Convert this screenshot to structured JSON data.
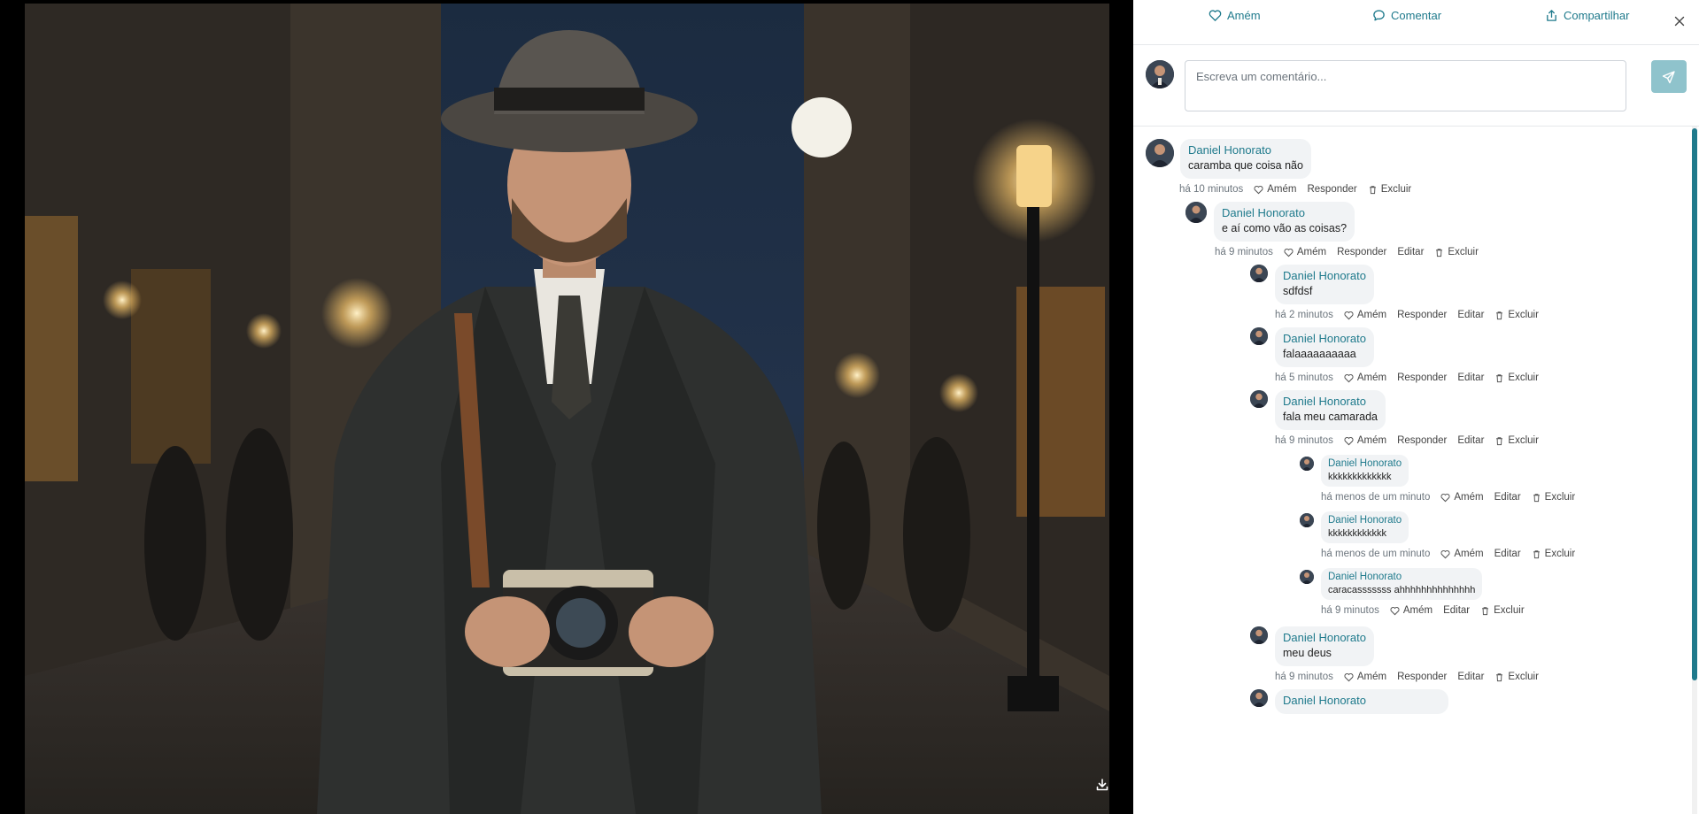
{
  "viewer": {
    "download_icon": "download-icon"
  },
  "actions": {
    "amen_label": "Amém",
    "comment_label": "Comentar",
    "share_label": "Compartilhar",
    "close_icon": "close-icon"
  },
  "composer": {
    "placeholder": "Escreva um comentário...",
    "value": ""
  },
  "colors": {
    "accent": "#1f7a8c",
    "send_button": "#8fc3cc",
    "bubble": "#f1f3f5"
  },
  "labels": {
    "amen": "Amém",
    "reply": "Responder",
    "edit": "Editar",
    "delete": "Excluir"
  },
  "comments": [
    {
      "author": "Daniel Honorato",
      "text": "caramba que coisa não",
      "time": "há 10 minutos"
    },
    {
      "author": "Daniel Honorato",
      "text": "e aí como vão as coisas?",
      "time": "há 9 minutos"
    },
    {
      "author": "Daniel Honorato",
      "text": "sdfdsf",
      "time": "há 2 minutos"
    },
    {
      "author": "Daniel Honorato",
      "text": "falaaaaaaaaaa",
      "time": "há 5 minutos"
    },
    {
      "author": "Daniel Honorato",
      "text": "fala meu camarada",
      "time": "há 9 minutos"
    },
    {
      "author": "Daniel Honorato",
      "text": "kkkkkkkkkkkkk",
      "time": "há menos de um minuto"
    },
    {
      "author": "Daniel Honorato",
      "text": "kkkkkkkkkkkk",
      "time": "há menos de um minuto"
    },
    {
      "author": "Daniel Honorato",
      "text": "caracasssssss ahhhhhhhhhhhhhh",
      "time": "há 9 minutos"
    },
    {
      "author": "Daniel Honorato",
      "text": "meu deus",
      "time": "há 9 minutos"
    },
    {
      "author": "Daniel Honorato",
      "text": "",
      "time": ""
    }
  ]
}
